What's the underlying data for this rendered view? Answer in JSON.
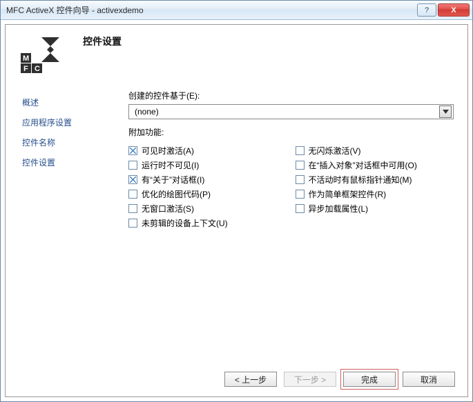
{
  "window": {
    "title": "MFC ActiveX 控件向导 - activexdemo"
  },
  "titlebar_buttons": {
    "help": "?",
    "close": "X"
  },
  "page_heading": "控件设置",
  "sidebar": {
    "items": [
      "概述",
      "应用程序设置",
      "控件名称",
      "控件设置"
    ]
  },
  "base_class": {
    "label": "创建的控件基于(E):",
    "value": "(none)"
  },
  "features_label": "附加功能:",
  "checks_left": [
    {
      "label": "可见时激活(A)",
      "checked": true
    },
    {
      "label": "运行时不可见(I)",
      "checked": false
    },
    {
      "label": "有“关于”对话框(I)",
      "checked": true
    },
    {
      "label": "优化的绘图代码(P)",
      "checked": false
    },
    {
      "label": "无窗口激活(S)",
      "checked": false
    },
    {
      "label": "未剪辑的设备上下文(U)",
      "checked": false
    }
  ],
  "checks_right": [
    {
      "label": "无闪烁激活(V)",
      "checked": false
    },
    {
      "label": "在“插入对象”对话框中可用(O)",
      "checked": false
    },
    {
      "label": "不活动时有鼠标指针通知(M)",
      "checked": false
    },
    {
      "label": "作为简单框架控件(R)",
      "checked": false
    },
    {
      "label": "异步加载属性(L)",
      "checked": false
    }
  ],
  "buttons": {
    "prev": "< 上一步",
    "next": "下一步 >",
    "finish": "完成",
    "cancel": "取消"
  }
}
